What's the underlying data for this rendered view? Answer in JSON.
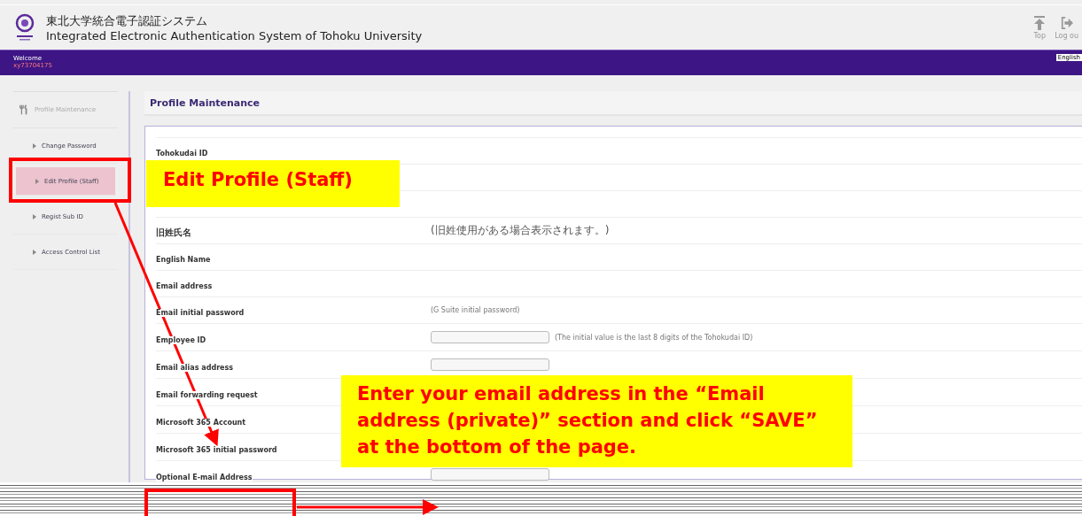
{
  "header": {
    "title_ja": "東北大学統合電子認証システム",
    "title_en": "Integrated Electronic Authentication System of Tohoku University",
    "actions": [
      {
        "kind": "top",
        "label": "Top"
      },
      {
        "kind": "logout",
        "label": "Log ou"
      }
    ]
  },
  "user_bar": {
    "welcome": "Welcome",
    "user_id": "xy73704175",
    "language": "English"
  },
  "sidebar": {
    "heading": "Profile Maintenance",
    "items": [
      {
        "label": "Change Password",
        "selected": false
      },
      {
        "label": "Edit Profile (Staff)",
        "selected": true
      },
      {
        "label": "Regist Sub ID",
        "selected": false
      },
      {
        "label": "Access Control List",
        "selected": false
      }
    ]
  },
  "main": {
    "title": "Profile Maintenance",
    "rows": [
      {
        "kind": "text",
        "label": "Tohokudai ID"
      },
      {
        "kind": "empty"
      },
      {
        "kind": "empty"
      },
      {
        "kind": "text",
        "label": "旧姓氏名",
        "note": "(旧姓使用がある場合表示されます。)"
      },
      {
        "kind": "text",
        "label": "English Name"
      },
      {
        "kind": "text",
        "label": "Email address"
      },
      {
        "kind": "text",
        "label": "Email initial password",
        "note": "(G Suite initial password)"
      },
      {
        "kind": "input",
        "label": "Employee ID",
        "note": "(The initial value is the last 8 digits of the Tohokudai ID)"
      },
      {
        "kind": "input",
        "label": "Email alias address"
      },
      {
        "kind": "text",
        "label": "Email forwarding request"
      },
      {
        "kind": "text",
        "label": "Microsoft 365 Account"
      },
      {
        "kind": "text",
        "label": "Microsoft 365 initial password"
      },
      {
        "kind": "input",
        "label": "Optional E-mail Address"
      }
    ]
  },
  "annotations": [
    {
      "kind": "callout",
      "text": "Edit Profile (Staff)"
    },
    {
      "kind": "callout",
      "text": "Enter your email address in the “Email address (private)” section and click “SAVE” at the bottom of the page."
    }
  ]
}
